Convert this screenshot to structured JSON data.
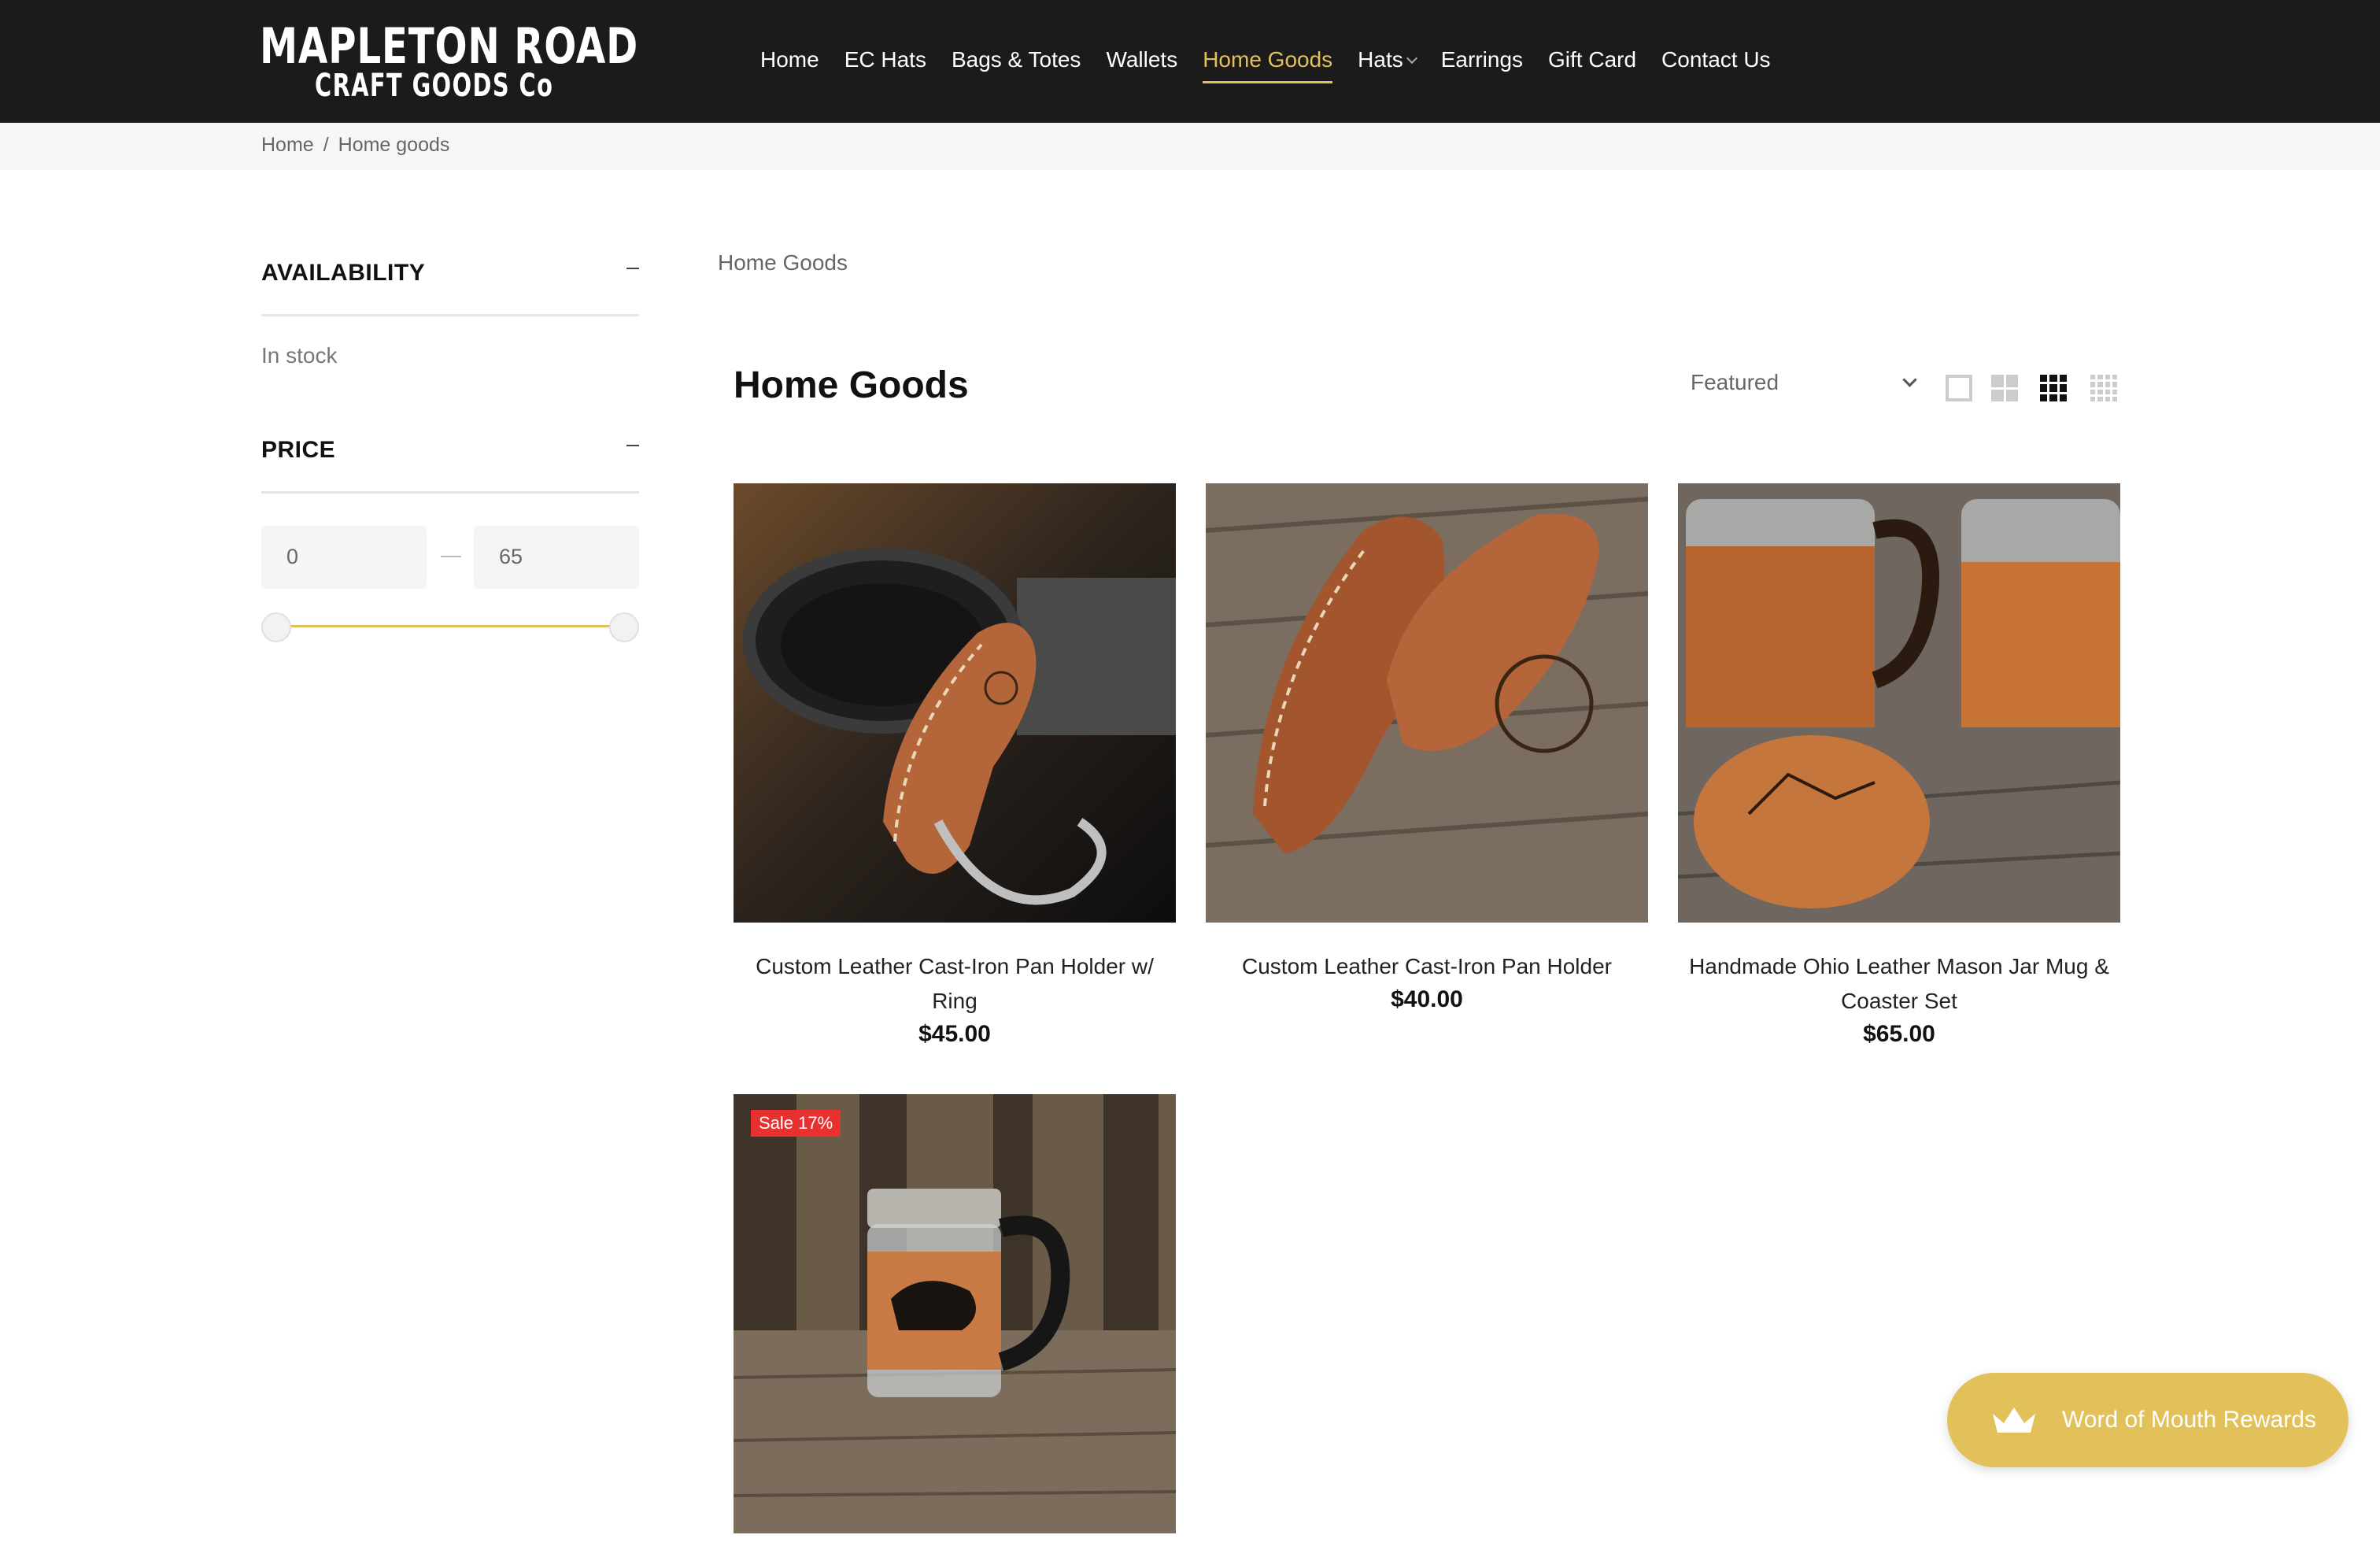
{
  "brand": {
    "line1": "MAPLETON ROAD",
    "line2": "CRAFT GOODS Co"
  },
  "nav": [
    {
      "label": "Home",
      "active": false
    },
    {
      "label": "EC Hats",
      "active": false
    },
    {
      "label": "Bags & Totes",
      "active": false
    },
    {
      "label": "Wallets",
      "active": false
    },
    {
      "label": "Home Goods",
      "active": true
    },
    {
      "label": "Hats",
      "active": false,
      "dropdown": true
    },
    {
      "label": "Earrings",
      "active": false
    },
    {
      "label": "Gift Card",
      "active": false
    },
    {
      "label": "Contact Us",
      "active": false
    }
  ],
  "breadcrumb": {
    "home": "Home",
    "sep": "/",
    "current": "Home goods"
  },
  "filters": {
    "availability": {
      "title": "AVAILABILITY",
      "option": "In stock"
    },
    "price": {
      "title": "PRICE",
      "min": "0",
      "max": "65"
    }
  },
  "collection": {
    "label": "Home Goods",
    "title": "Home Goods",
    "sort": "Featured"
  },
  "products": [
    {
      "name": "Custom Leather Cast-Iron Pan Holder w/ Ring",
      "price": "$45.00"
    },
    {
      "name": "Custom Leather Cast-Iron Pan Holder",
      "price": "$40.00"
    },
    {
      "name": "Handmade Ohio Leather Mason Jar Mug & Coaster Set",
      "price": "$65.00"
    },
    {
      "name": "",
      "price": "",
      "badge": "Sale 17%"
    }
  ],
  "rewards": {
    "label": "Word of Mouth Rewards"
  },
  "colors": {
    "accent": "#e3c15a",
    "header": "#1b1b1b",
    "sale": "#e8312f"
  }
}
